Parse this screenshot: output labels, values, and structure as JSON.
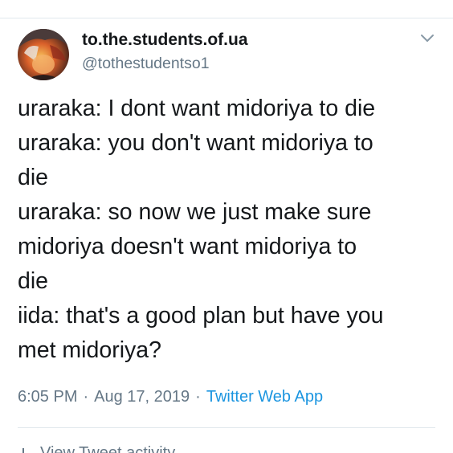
{
  "tweet": {
    "author": {
      "display_name": "to.the.students.of.ua",
      "handle": "@tothestudentso1",
      "avatar_icon": "avatar-portrait"
    },
    "menu_icon": "chevron-down-icon",
    "text_lines": [
      "uraraka: I dont want midoriya to die",
      "uraraka: you don't want midoriya to",
      "die",
      "uraraka: so now we just make sure",
      "midoriya doesn't want midoriya to",
      "die",
      "iida: that's a good plan but have you",
      "met midoriya?"
    ],
    "time": "6:05 PM",
    "separator": "·",
    "date": "Aug 17, 2019",
    "source": "Twitter Web App",
    "activity_label": "View Tweet activity"
  },
  "colors": {
    "text": "#14171a",
    "secondary": "#657786",
    "link": "#1b95e0",
    "divider": "#e1e8ed"
  }
}
